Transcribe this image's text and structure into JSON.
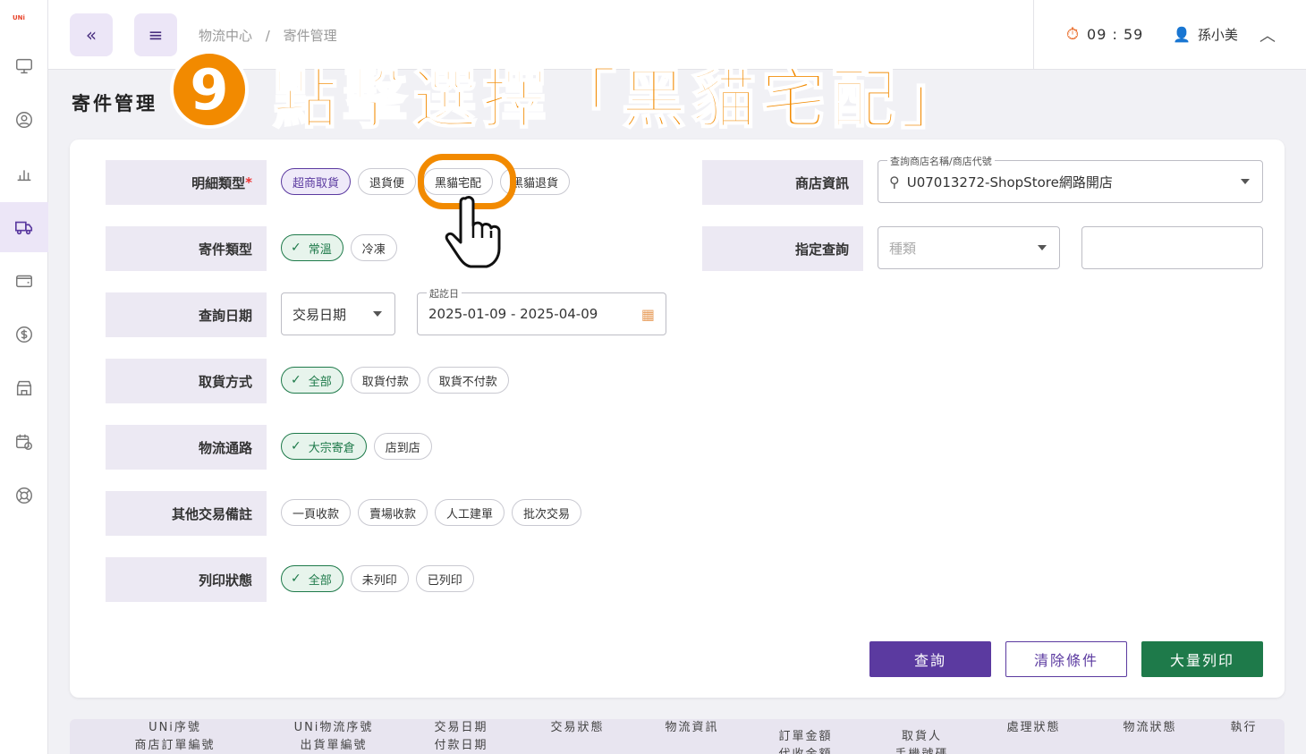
{
  "brand": "UNi",
  "breadcrumb": [
    "物流中心",
    "/",
    "寄件管理"
  ],
  "header": {
    "timer": "09 : 59",
    "user_name": "孫小美"
  },
  "page_title": "寄件管理",
  "annotation": {
    "step_number": "9",
    "instruction": "點擊選擇「黑貓宅配」"
  },
  "form": {
    "detail_type": {
      "label": "明細類型",
      "required_mark": "*",
      "options": [
        "超商取貨",
        "退貨便",
        "黑貓宅配",
        "黑貓退貨"
      ]
    },
    "ship_type": {
      "label": "寄件類型",
      "options": [
        "常溫",
        "冷凍"
      ]
    },
    "query_date": {
      "label": "查詢日期",
      "select_value": "交易日期",
      "range_label": "起訖日",
      "range_value": "2025-01-09 - 2025-04-09"
    },
    "pickup": {
      "label": "取貨方式",
      "options": [
        "全部",
        "取貨付款",
        "取貨不付款"
      ]
    },
    "channel": {
      "label": "物流通路",
      "options": [
        "大宗寄倉",
        "店到店"
      ]
    },
    "remarks": {
      "label": "其他交易備註",
      "options": [
        "一頁收款",
        "賣場收款",
        "人工建單",
        "批次交易"
      ]
    },
    "print_status": {
      "label": "列印狀態",
      "options": [
        "全部",
        "未列印",
        "已列印"
      ]
    },
    "store": {
      "label": "商店資訊",
      "float_label": "查詢商店名稱/商店代號",
      "value": "U07013272-ShopStore網路開店"
    },
    "assign_query": {
      "label": "指定查詢",
      "type_placeholder": "種類"
    }
  },
  "buttons": {
    "query": "查詢",
    "clear": "清除條件",
    "bulk_print": "大量列印"
  },
  "table_headers": [
    [
      "UNi序號",
      "商店訂單編號"
    ],
    [
      "UNi物流序號",
      "出貨單編號"
    ],
    [
      "交易日期",
      "付款日期"
    ],
    [
      "",
      "交易狀態"
    ],
    [
      "",
      "物流資訊"
    ],
    [
      "訂單金額",
      "代收金額"
    ],
    [
      "取貨人",
      "手機號碼"
    ],
    [
      "",
      "處理狀態"
    ],
    [
      "",
      "物流狀態"
    ],
    [
      "",
      "執行"
    ]
  ],
  "colors": {
    "primary": "#5b3aa0",
    "green": "#1e7a4a",
    "annotation": "#f28a00"
  }
}
